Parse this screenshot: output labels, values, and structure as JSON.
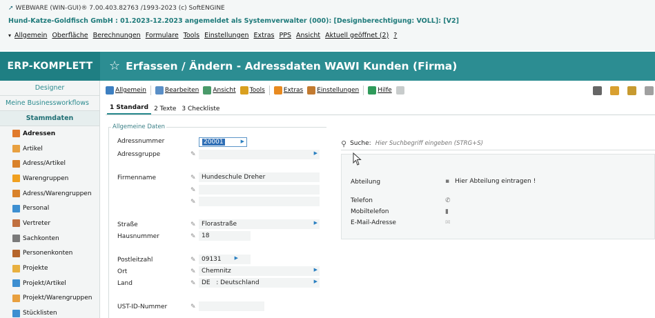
{
  "window": {
    "title": "WEBWARE (WIN-GUI)® 7.00.403.82763 /1993-2023 (c) SoftENGINE",
    "company_line": "Hund-Katze-Goldfisch GmbH : 01.2023-12.2023 angemeldet als Systemverwalter (000): [Designberechtigung: VOLL]: [V2]"
  },
  "menu": {
    "items": [
      "Allgemein",
      "Oberfläche",
      "Berechnungen",
      "Formulare",
      "Tools",
      "Einstellungen",
      "Extras",
      "PPS",
      "Ansicht",
      "Aktuell geöffnet (2)",
      "?"
    ]
  },
  "header": {
    "brand": "ERP-KOMPLETT",
    "page_title": "Erfassen / Ändern - Adressdaten WAWI Kunden (Firma)"
  },
  "sidebar": {
    "sections": [
      "Designer",
      "Meine Businessworkflows",
      "Stammdaten"
    ],
    "items": [
      {
        "label": "Adressen",
        "color": "#e07a2c"
      },
      {
        "label": "Artikel",
        "color": "#e8a040"
      },
      {
        "label": "Adress/Artikel",
        "color": "#d9822b"
      },
      {
        "label": "Warengruppen",
        "color": "#f0a020"
      },
      {
        "label": "Adress/Warengruppen",
        "color": "#d9822b"
      },
      {
        "label": "Personal",
        "color": "#3d8fd1"
      },
      {
        "label": "Vertreter",
        "color": "#c07040"
      },
      {
        "label": "Sachkonten",
        "color": "#7a7a7a"
      },
      {
        "label": "Personenkonten",
        "color": "#b5652b"
      },
      {
        "label": "Projekte",
        "color": "#e8b040"
      },
      {
        "label": "Projekt/Artikel",
        "color": "#3d8fd1"
      },
      {
        "label": "Projekt/Warengruppen",
        "color": "#e8a040"
      },
      {
        "label": "Stücklisten",
        "color": "#3d8fd1"
      }
    ]
  },
  "toolbar": {
    "buttons": [
      {
        "label": "Allgemein",
        "icon": "home-icon",
        "color": "#3d7fc1"
      },
      {
        "label": "Bearbeiten",
        "icon": "edit-icon",
        "color": "#5a8fc7"
      },
      {
        "label": "Ansicht",
        "icon": "view-icon",
        "color": "#4a9a6a"
      },
      {
        "label": "Tools",
        "icon": "tools-icon",
        "color": "#d9a020"
      },
      {
        "label": "Extras",
        "icon": "extras-icon",
        "color": "#e88a20"
      },
      {
        "label": "Einstellungen",
        "icon": "settings-icon",
        "color": "#c27a30"
      },
      {
        "label": "Hilfe",
        "icon": "help-icon",
        "color": "#2f9a5a"
      }
    ],
    "right_icons": [
      {
        "name": "users-icon",
        "color": "#666666"
      },
      {
        "name": "notes-icon",
        "color": "#d9a030"
      },
      {
        "name": "person-icon",
        "color": "#c79a30"
      },
      {
        "name": "chat-icon",
        "color": "#a0a0a0"
      }
    ]
  },
  "tabs": [
    {
      "label": "1 Standard",
      "active": true
    },
    {
      "label": "2 Texte",
      "active": false
    },
    {
      "label": "3 Checkliste",
      "active": false
    }
  ],
  "form": {
    "group_title": "Allgemeine Daten",
    "fields": {
      "adressnummer": {
        "label": "Adressnummer",
        "value": "20001"
      },
      "adressgruppe": {
        "label": "Adressgruppe",
        "value": ""
      },
      "firmenname": {
        "label": "Firmenname",
        "value": "Hundeschule Dreher"
      },
      "strasse": {
        "label": "Straße",
        "value": "Florastraße"
      },
      "hausnummer": {
        "label": "Hausnummer",
        "value": "18"
      },
      "postleitzahl": {
        "label": "Postleitzahl",
        "value": "09131"
      },
      "ort": {
        "label": "Ort",
        "value": "Chemnitz"
      },
      "land": {
        "label": "Land",
        "value": "DE   : Deutschland"
      },
      "ust_id": {
        "label": "UST-ID-Nummer",
        "value": ""
      }
    }
  },
  "search": {
    "label": "Suche:",
    "placeholder": "Hier Suchbegriff eingeben (STRG+S)"
  },
  "contact": {
    "abteilung_label": "Abteilung",
    "abteilung_value": "Hier Abteilung eintragen !",
    "telefon_label": "Telefon",
    "mobil_label": "Mobiltelefon",
    "email_label": "E-Mail-Adresse"
  }
}
